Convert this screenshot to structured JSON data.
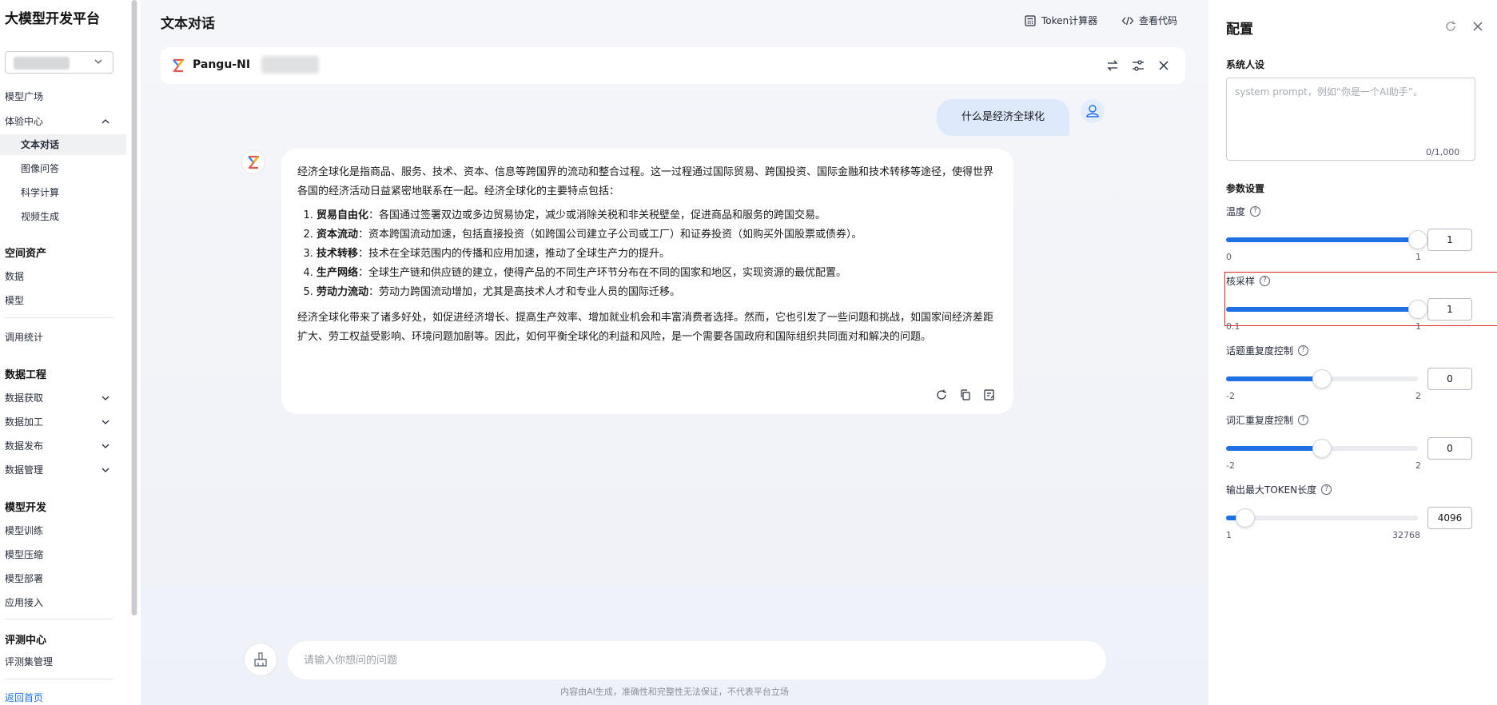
{
  "sidebar": {
    "title": "大模型开发平台",
    "items": [
      {
        "label": "模型广场"
      },
      {
        "label": "体验中心"
      },
      {
        "label": "文本对话"
      },
      {
        "label": "图像问答"
      },
      {
        "label": "科学计算"
      },
      {
        "label": "视频生成"
      },
      {
        "label": "空间资产"
      },
      {
        "label": "数据"
      },
      {
        "label": "模型"
      },
      {
        "label": "调用统计"
      },
      {
        "label": "数据工程"
      },
      {
        "label": "数据获取"
      },
      {
        "label": "数据加工"
      },
      {
        "label": "数据发布"
      },
      {
        "label": "数据管理"
      },
      {
        "label": "模型开发"
      },
      {
        "label": "模型训练"
      },
      {
        "label": "模型压缩"
      },
      {
        "label": "模型部署"
      },
      {
        "label": "应用接入"
      },
      {
        "label": "评测中心"
      },
      {
        "label": "评测集管理"
      },
      {
        "label": "返回首页"
      }
    ]
  },
  "main": {
    "title": "文本对话",
    "token_calc_label": "Token计算器",
    "view_code_label": "查看代码",
    "model_name": "Pangu-NI",
    "user_message": "什么是经济全球化",
    "ai_message": {
      "intro": "经济全球化是指商品、服务、技术、资本、信息等跨国界的流动和整合过程。这一过程通过国际贸易、跨国投资、国际金融和技术转移等途径，使得世界各国的经济活动日益紧密地联系在一起。经济全球化的主要特点包括：",
      "points": [
        {
          "title": "贸易自由化",
          "text": "：各国通过签署双边或多边贸易协定，减少或消除关税和非关税壁垒，促进商品和服务的跨国交易。"
        },
        {
          "title": "资本流动",
          "text": "：资本跨国流动加速，包括直接投资（如跨国公司建立子公司或工厂）和证券投资（如购买外国股票或债券）。"
        },
        {
          "title": "技术转移",
          "text": "：技术在全球范围内的传播和应用加速，推动了全球生产力的提升。"
        },
        {
          "title": "生产网络",
          "text": "：全球生产链和供应链的建立，使得产品的不同生产环节分布在不同的国家和地区，实现资源的最优配置。"
        },
        {
          "title": "劳动力流动",
          "text": "：劳动力跨国流动增加，尤其是高技术人才和专业人员的国际迁移。"
        }
      ],
      "conclusion": "经济全球化带来了诸多好处，如促进经济增长、提高生产效率、增加就业机会和丰富消费者选择。然而，它也引发了一些问题和挑战，如国家间经济差距扩大、劳工权益受影响、环境问题加剧等。因此，如何平衡全球化的利益和风险，是一个需要各国政府和国际组织共同面对和解决的问题。"
    },
    "input_placeholder": "请输入你想问的问题",
    "disclaimer": "内容由AI生成，准确性和完整性无法保证，不代表平台立场"
  },
  "panel": {
    "title": "配置",
    "system_label": "系统人设",
    "system_placeholder": "system prompt，例如“你是一个AI助手”。",
    "system_counter": "0/1,000",
    "params_label": "参数设置",
    "temperature": {
      "label": "温度",
      "value": "1",
      "fraction": 1.0,
      "min": "0",
      "max": "1"
    },
    "top_p": {
      "label": "核采样",
      "value": "1",
      "fraction": 1.0,
      "min": "0.1",
      "max": "1"
    },
    "presence_penalty": {
      "label": "话题重复度控制",
      "value": "0",
      "fraction": 0.5,
      "min": "-2",
      "max": "2"
    },
    "frequency_penalty": {
      "label": "词汇重复度控制",
      "value": "0",
      "fraction": 0.5,
      "min": "-2",
      "max": "2"
    },
    "max_tokens": {
      "label": "输出最大TOKEN长度",
      "value": "4096",
      "fraction": 0.1,
      "min": "1",
      "max": "32768"
    }
  },
  "colors": {
    "accent": "#1f6fe5",
    "highlight": "#e02424",
    "user_bubble": "#dde8fb"
  }
}
